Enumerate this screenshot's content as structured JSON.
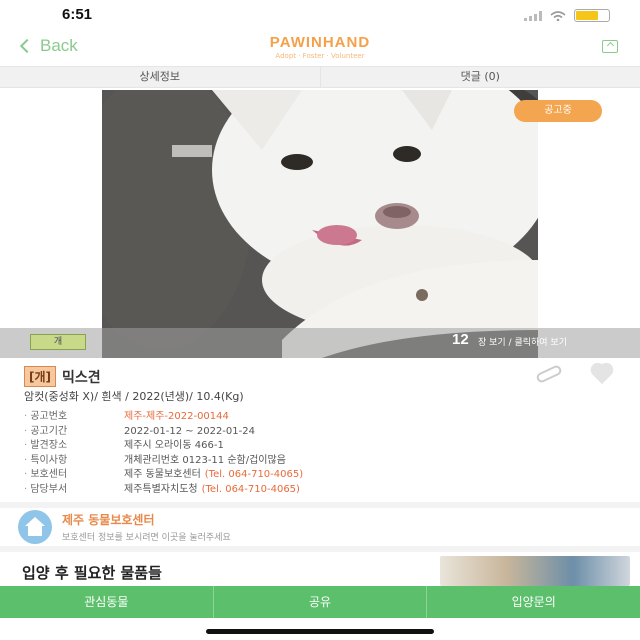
{
  "status_bar": {
    "time": "6:51"
  },
  "nav": {
    "back_label": "Back",
    "brand_name": "PAWINHAND",
    "brand_tagline": "Adopt · Foster · Volunteer"
  },
  "tabs": [
    {
      "label": "상세정보"
    },
    {
      "label": "댓글 (0)"
    }
  ],
  "photo": {
    "status_label": "공고중",
    "kind_tag": "개",
    "count": "12",
    "more_label": "장 보기 / 클릭하여 보기"
  },
  "animal": {
    "breed_tag": "[개]",
    "breed_name": "믹스견",
    "summary": "암컷(중성화 X)/ 흰색 / 2022(년생)/ 10.4(Kg)",
    "details": [
      {
        "label": "공고번호",
        "value": "제주-제주-2022-00144",
        "accent": true
      },
      {
        "label": "공고기간",
        "value": "2022-01-12 ~ 2022-01-24"
      },
      {
        "label": "발견장소",
        "value": "제주시 오라이동 466-1"
      },
      {
        "label": "특이사항",
        "value": "개체관리번호 0123-11 순함/겁이많음"
      },
      {
        "label": "보호센터",
        "value": "제주 동물보호센터",
        "phone": "(Tel. 064-710-4065)"
      },
      {
        "label": "담당부서",
        "value": "제주특별자치도청",
        "phone": "(Tel. 064-710-4065)"
      }
    ]
  },
  "shelter": {
    "name": "제주 동물보호센터",
    "subtitle": "보호센터 정보를 보시려면 이곳을 눌러주세요"
  },
  "teaser": {
    "title": "입양 후 필요한 물품들"
  },
  "bottom_bar": [
    {
      "label": "관심동물"
    },
    {
      "label": "공유"
    },
    {
      "label": "입양문의"
    }
  ],
  "colors": {
    "brand_orange": "#f5a04a",
    "accent_green": "#5bbf6b",
    "status_orange": "#f3a64f"
  }
}
